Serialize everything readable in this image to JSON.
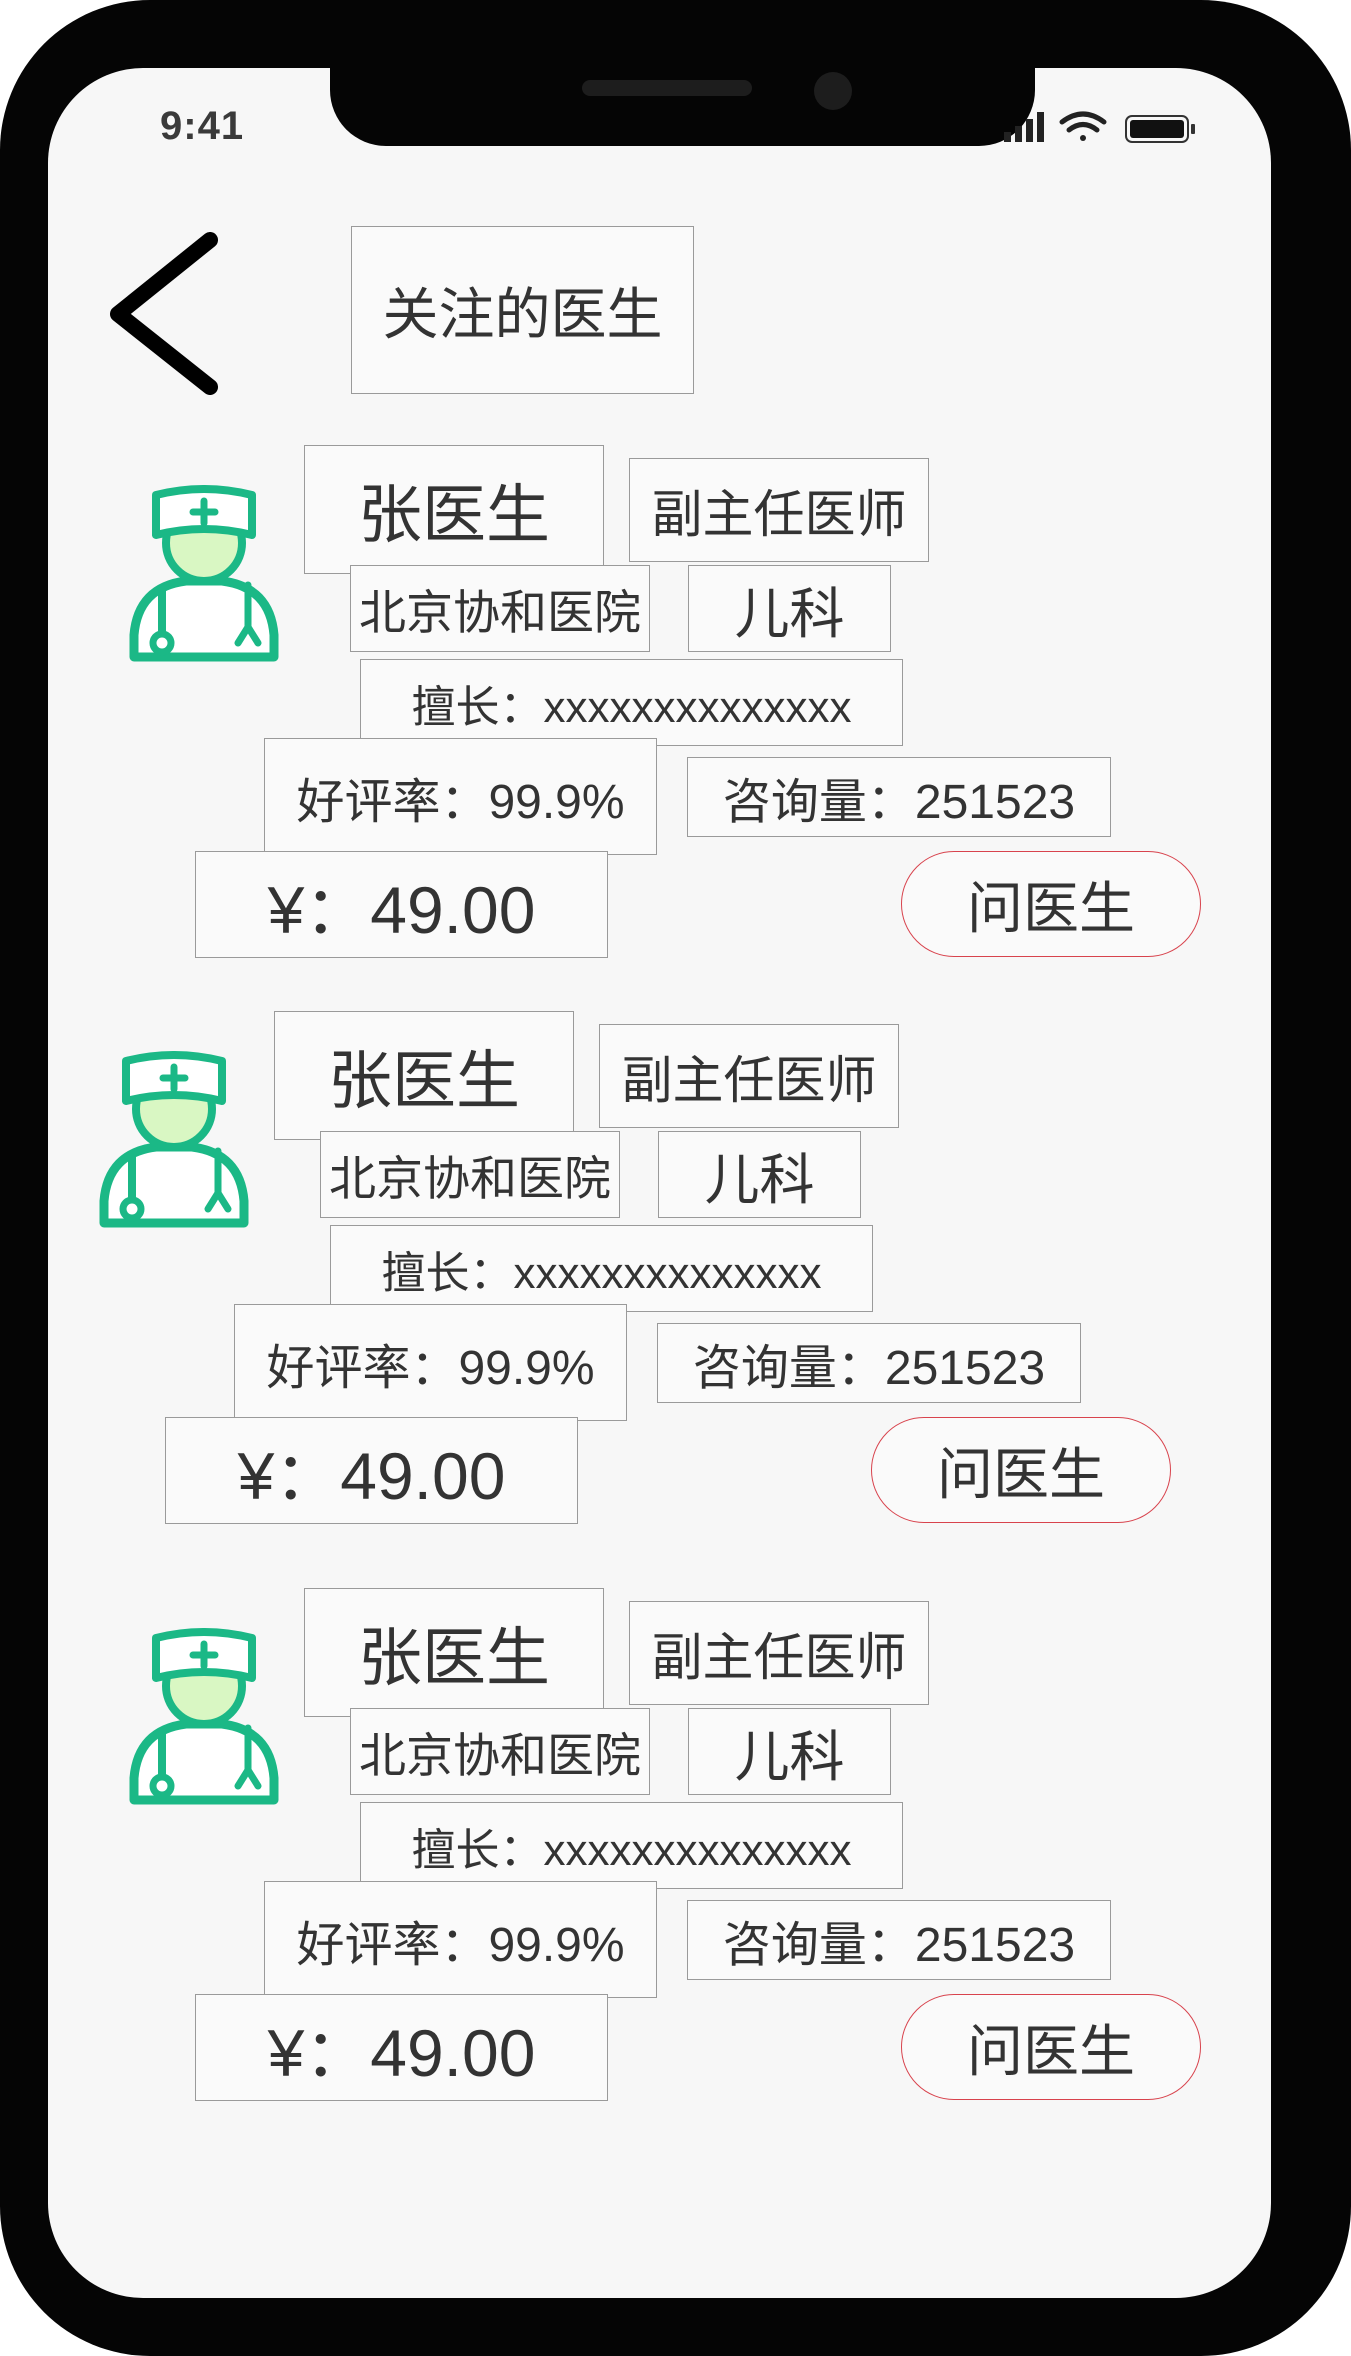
{
  "status_bar": {
    "time": "9:41"
  },
  "header": {
    "title": "关注的医生"
  },
  "colors": {
    "avatar": "#1bb886",
    "avatar_face": "#d9f7c3",
    "ask_border": "#d8434d"
  },
  "doctors": [
    {
      "name": "张医生",
      "title": "副主任医师",
      "hospital": "北京协和医院",
      "department": "儿科",
      "specialty": "擅长：xxxxxxxxxxxxxx",
      "rating": "好评率：99.9%",
      "consultations": "咨询量：251523",
      "price": "¥：49.00",
      "ask_label": "问医生"
    },
    {
      "name": "张医生",
      "title": "副主任医师",
      "hospital": "北京协和医院",
      "department": "儿科",
      "specialty": "擅长：xxxxxxxxxxxxxx",
      "rating": "好评率：99.9%",
      "consultations": "咨询量：251523",
      "price": "¥：49.00",
      "ask_label": "问医生"
    },
    {
      "name": "张医生",
      "title": "副主任医师",
      "hospital": "北京协和医院",
      "department": "儿科",
      "specialty": "擅长：xxxxxxxxxxxxxx",
      "rating": "好评率：99.9%",
      "consultations": "咨询量：251523",
      "price": "¥：49.00",
      "ask_label": "问医生"
    }
  ]
}
